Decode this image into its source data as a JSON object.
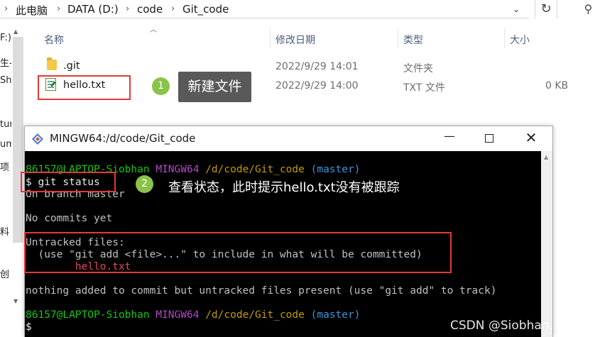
{
  "address_bar": {
    "crumbs": [
      "此电脑",
      "DATA (D:)",
      "code",
      "Git_code"
    ],
    "dropdown_icon": "chevron-down-icon",
    "refresh_icon": "refresh-icon",
    "search_icon": "search-icon"
  },
  "nav_pane": {
    "fragments": [
      "F:)",
      "生-",
      "Sh",
      "tur",
      "um",
      "项",
      "料",
      "创"
    ]
  },
  "columns": {
    "name": "名称",
    "modified": "修改日期",
    "type": "类型",
    "size": "大小"
  },
  "files": [
    {
      "name": ".git",
      "modified": "2022/9/29 14:01",
      "type": "文件夹",
      "size": "",
      "icon": "folder-icon"
    },
    {
      "name": "hello.txt",
      "modified": "2022/9/29 14:00",
      "type": "TXT 文件",
      "size": "0 KB",
      "icon": "text-file-icon"
    }
  ],
  "annotations": {
    "step1_number": "1",
    "step1_label": "新建文件",
    "step2_number": "2",
    "step2_label": "查看状态，此时提示hello.txt没有被跟踪",
    "highlight_color": "#e53935",
    "badge_color": "#8bc34a"
  },
  "terminal": {
    "title": "MINGW64:/d/code/Git_code",
    "prompt_user": "86157@LAPTOP-Siobhan",
    "prompt_env": "MINGW64",
    "prompt_path": "/d/code/Git_code",
    "prompt_branch": "(master)",
    "command_line": "$ git status",
    "line_branch": "On branch master",
    "line_commits": "No commits yet",
    "line_untracked": "Untracked files:",
    "line_hint": "  (use \"git add <file>...\" to include in what will be committed)",
    "untracked_file": "        hello.txt",
    "line_summary": "nothing added to commit but untracked files present (use \"git add\" to track)",
    "final_prompt": "$"
  },
  "watermark": "CSDN @Siobhan. 明鑫"
}
